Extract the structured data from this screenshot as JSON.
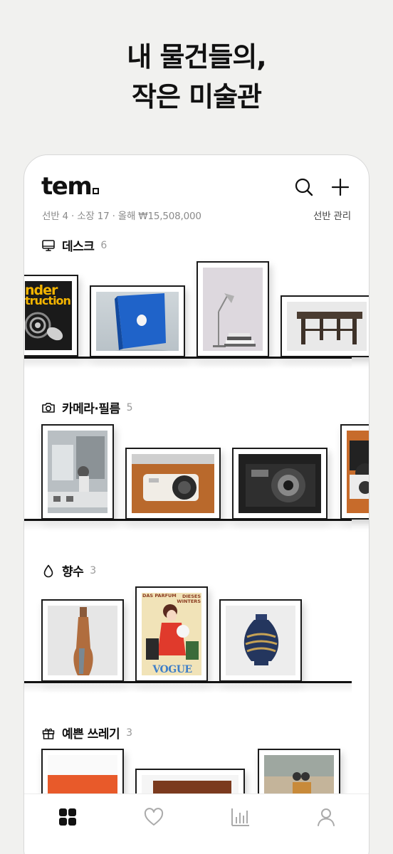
{
  "headline": {
    "line1": "내 물건들의,",
    "line2": "작은 미술관"
  },
  "app": {
    "logo": "tem",
    "stats": "선반 4 · 소장 17 · 올해 ₩15,508,000",
    "manage_label": "선반 관리"
  },
  "icons": {
    "search": "search-icon",
    "add": "plus-icon"
  },
  "shelves": [
    {
      "label": "데스크",
      "count": "6",
      "icon": "monitor-icon"
    },
    {
      "label": "카메라·필름",
      "count": "5",
      "icon": "camera-icon"
    },
    {
      "label": "향수",
      "count": "3",
      "icon": "drop-icon"
    },
    {
      "label": "예쁜 쓰레기",
      "count": "3",
      "icon": "gift-icon"
    }
  ],
  "artwork_text": {
    "desk_poster_line1": "nder",
    "desk_poster_line2": "truction",
    "perfume_poster_top_left": "DAS PARFUM",
    "perfume_poster_top_right": "DIESES WINTERS",
    "perfume_poster_brand": "VOGUE"
  },
  "tabbar": [
    {
      "name": "home",
      "icon": "grid-icon",
      "active": true
    },
    {
      "name": "favorites",
      "icon": "heart-icon",
      "active": false
    },
    {
      "name": "stats",
      "icon": "bar-chart-icon",
      "active": false
    },
    {
      "name": "profile",
      "icon": "person-icon",
      "active": false
    }
  ],
  "colors": {
    "background": "#f1f1ef",
    "text": "#111111",
    "muted": "#8a8a8a"
  }
}
